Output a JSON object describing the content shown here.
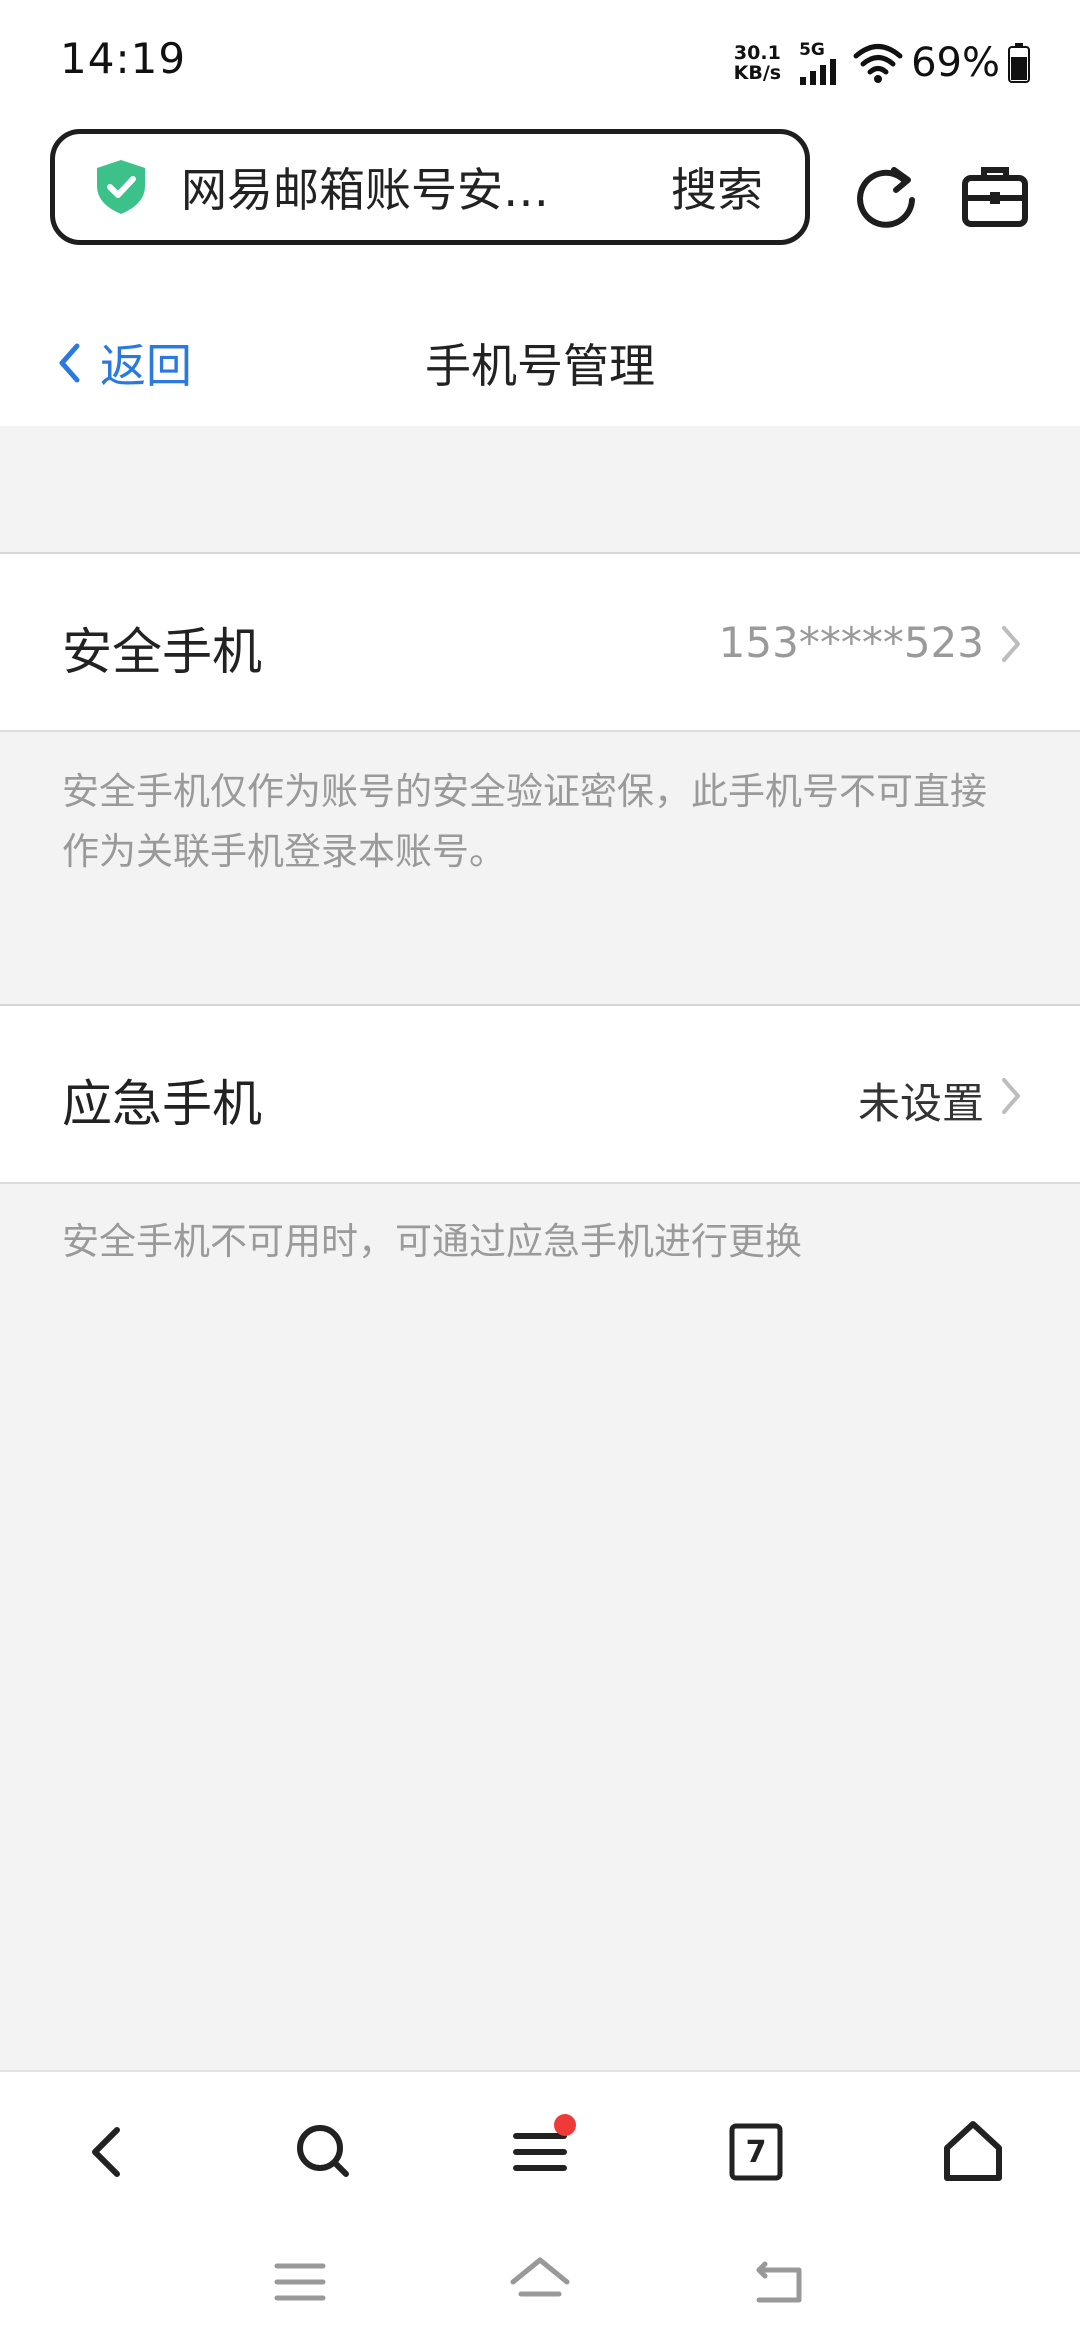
{
  "status_bar": {
    "time": "14:19",
    "net_speed_value": "30.1",
    "net_speed_unit": "KB/s",
    "network_type": "5G",
    "battery_percent": "69%"
  },
  "address_bar": {
    "url_text": "网易邮箱账号安…",
    "search_label": "搜索",
    "secure_icon": "shield-check-icon",
    "accent_color": "#3cc18a"
  },
  "header": {
    "back_label": "返回",
    "title": "手机号管理",
    "link_color": "#2a79df"
  },
  "rows": [
    {
      "label": "安全手机",
      "value": "153*****523",
      "note": "安全手机仅作为账号的安全验证密保，此手机号不可直接作为关联手机登录本账号。"
    },
    {
      "label": "应急手机",
      "value": "未设置",
      "note": "安全手机不可用时，可通过应急手机进行更换"
    }
  ],
  "bottom_toolbar": {
    "tab_count": "7",
    "notification_dot_color": "#f03a3a"
  }
}
